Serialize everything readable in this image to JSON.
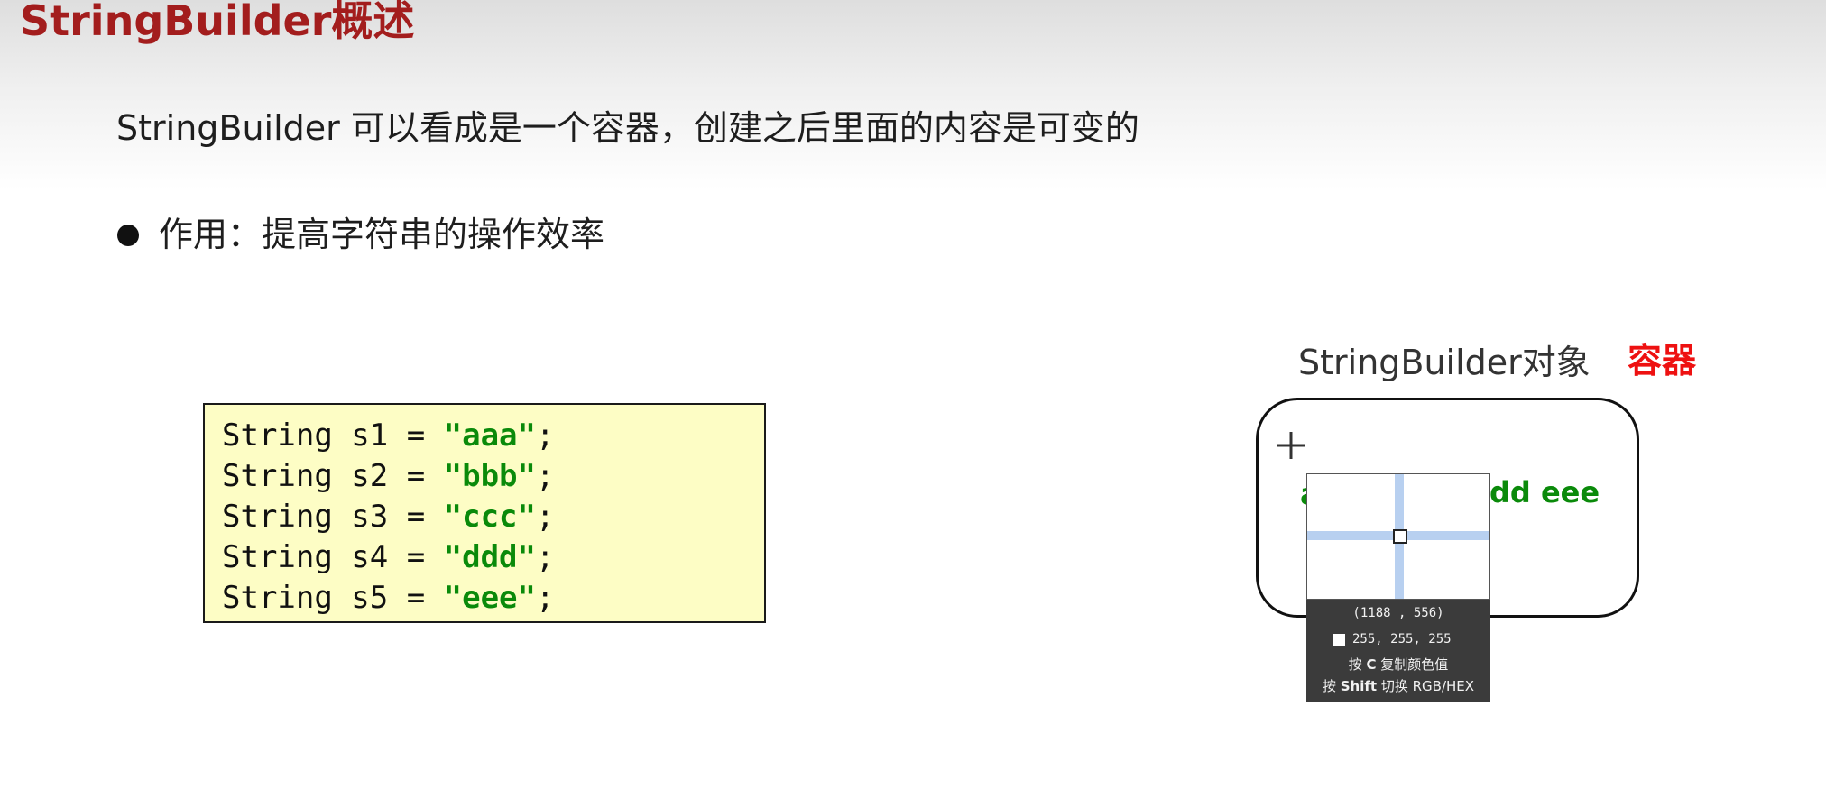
{
  "slide": {
    "title": "StringBuilder概述",
    "subtitle": "StringBuilder 可以看成是一个容器，创建之后里面的内容是可变的",
    "bullet": "作用：提高字符串的操作效率"
  },
  "code": {
    "lines": [
      {
        "prefix": "String s1 = ",
        "literal": "\"aaa\"",
        "suffix": ";"
      },
      {
        "prefix": "String s2 = ",
        "literal": "\"bbb\"",
        "suffix": ";"
      },
      {
        "prefix": "String s3 = ",
        "literal": "\"ccc\"",
        "suffix": ";"
      },
      {
        "prefix": "String s4 = ",
        "literal": "\"ddd\"",
        "suffix": ";"
      },
      {
        "prefix": "String s5 = ",
        "literal": "\"eee\"",
        "suffix": ";"
      }
    ]
  },
  "diagram": {
    "object_label": "StringBuilder对象",
    "container_label": "容器",
    "partial_left": "a",
    "visible_values": "dd eee"
  },
  "color_picker": {
    "coords": "(1188 , 556)",
    "rgb": "255, 255, 255",
    "swatch_color": "#ffffff",
    "hint1_pre": "按",
    "hint1_key": "C",
    "hint1_post": "复制颜色值",
    "hint2_pre": "按",
    "hint2_key": "Shift",
    "hint2_post": "切换 RGB/HEX"
  },
  "colors": {
    "title": "#a31d1d",
    "string_literal": "#0a8a0a",
    "code_background": "#fdfdc5",
    "container_label": "#ee1111",
    "picker_panel": "#3b3b3b",
    "crosshair": "#b8d0f0"
  },
  "icons": [
    "crosshair-cursor-icon",
    "bullet-icon"
  ]
}
